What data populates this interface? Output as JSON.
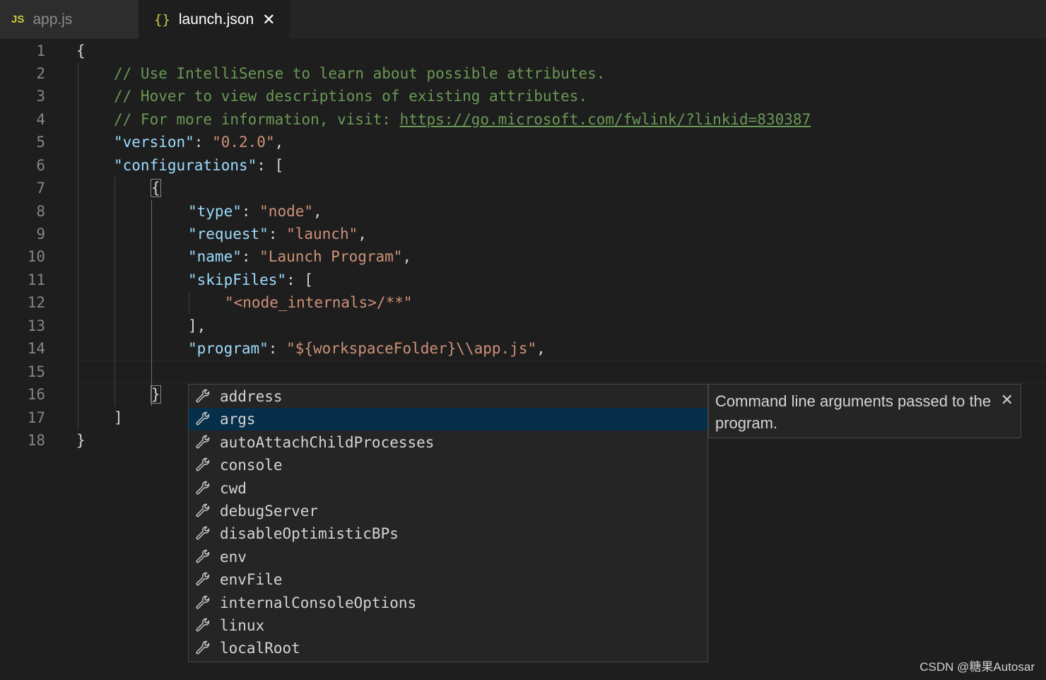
{
  "tabs": [
    {
      "icon": "JS",
      "label": "app.js",
      "active": false
    },
    {
      "icon": "{}",
      "label": "launch.json",
      "active": true,
      "close": "✕"
    }
  ],
  "line_numbers": [
    "1",
    "2",
    "3",
    "4",
    "5",
    "6",
    "7",
    "8",
    "9",
    "10",
    "11",
    "12",
    "13",
    "14",
    "15",
    "16",
    "17",
    "18"
  ],
  "code": {
    "l1": "{",
    "l2": "// Use IntelliSense to learn about possible attributes.",
    "l3": "// Hover to view descriptions of existing attributes.",
    "l4_text": "// For more information, visit: ",
    "l4_link": "https://go.microsoft.com/fwlink/?linkid=830387",
    "l5_key": "\"version\"",
    "l5_val": "\"0.2.0\"",
    "l6_key": "\"configurations\"",
    "l6_rest": "[",
    "l7": "{",
    "l8_key": "\"type\"",
    "l8_val": "\"node\"",
    "l9_key": "\"request\"",
    "l9_val": "\"launch\"",
    "l10_key": "\"name\"",
    "l10_val": "\"Launch Program\"",
    "l11_key": "\"skipFiles\"",
    "l11_rest": "[",
    "l12_val": "\"<node_internals>/**\"",
    "l13": "],",
    "l14_key": "\"program\"",
    "l14_val": "\"${workspaceFolder}\\\\app.js\"",
    "l16": "}",
    "l17": "]",
    "l18": "}"
  },
  "suggestions": [
    {
      "label": "address",
      "icon": "wrench-icon"
    },
    {
      "label": "args",
      "icon": "wrench-icon",
      "selected": true
    },
    {
      "label": "autoAttachChildProcesses",
      "icon": "wrench-icon"
    },
    {
      "label": "console",
      "icon": "wrench-icon"
    },
    {
      "label": "cwd",
      "icon": "wrench-icon"
    },
    {
      "label": "debugServer",
      "icon": "wrench-icon"
    },
    {
      "label": "disableOptimisticBPs",
      "icon": "wrench-icon"
    },
    {
      "label": "env",
      "icon": "wrench-icon"
    },
    {
      "label": "envFile",
      "icon": "wrench-icon"
    },
    {
      "label": "internalConsoleOptions",
      "icon": "wrench-icon"
    },
    {
      "label": "linux",
      "icon": "wrench-icon"
    },
    {
      "label": "localRoot",
      "icon": "wrench-icon"
    }
  ],
  "details": {
    "text": "Command line arguments passed to the program.",
    "close": "✕"
  },
  "watermark": "CSDN @糖果Autosar",
  "colors": {
    "background": "#1e1e1e",
    "comment": "#6a9955",
    "key": "#9cdcfe",
    "string": "#ce9178",
    "selection": "#062f4a"
  }
}
